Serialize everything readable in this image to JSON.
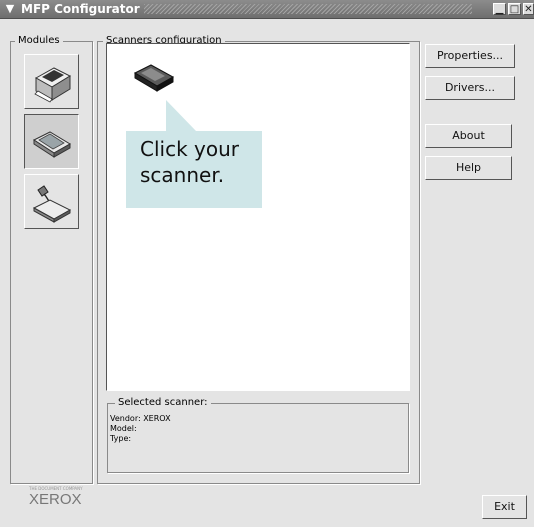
{
  "window": {
    "title": "MFP Configurator",
    "menu_icon": "chevron-down-icon",
    "minimize_icon": "minimize-icon",
    "maximize_icon": "maximize-icon",
    "close_icon": "close-icon"
  },
  "modules": {
    "label": "Modules",
    "items": [
      {
        "name": "printer",
        "icon": "printer-icon",
        "active": false
      },
      {
        "name": "scanner",
        "icon": "scanner-icon",
        "active": true
      },
      {
        "name": "port",
        "icon": "port-icon",
        "active": false
      }
    ]
  },
  "scanners": {
    "label": "Scanners configuration",
    "device_icon": "scanner-device-icon"
  },
  "callout": {
    "line1": "Click your",
    "line2": "scanner."
  },
  "buttons": {
    "properties": "Properties...",
    "drivers": "Drivers...",
    "about": "About",
    "help": "Help",
    "exit": "Exit"
  },
  "selected_scanner": {
    "label": "Selected scanner:",
    "vendor": "Vendor: XEROX",
    "model": "Model:",
    "type": "Type:"
  },
  "logo": {
    "name": "XEROX",
    "tagline": "THE DOCUMENT COMPANY"
  }
}
